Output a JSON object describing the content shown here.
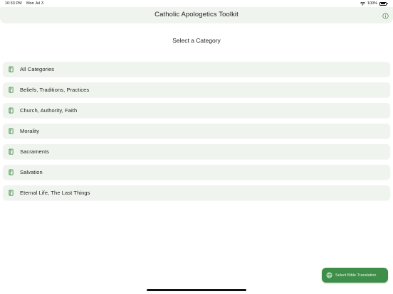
{
  "status_bar": {
    "time": "10:33 PM",
    "date": "Mon Jul 3",
    "battery": "100%"
  },
  "app_bar": {
    "title": "Catholic Apologetics Toolkit"
  },
  "main": {
    "section_title": "Select a Category",
    "categories": [
      {
        "label": "All Categories"
      },
      {
        "label": "Beliefs, Traditions, Practices"
      },
      {
        "label": "Church, Authority, Faith"
      },
      {
        "label": "Morality"
      },
      {
        "label": "Sacraments"
      },
      {
        "label": "Salvation"
      },
      {
        "label": "Eternal Life, The Last Things"
      }
    ]
  },
  "fab": {
    "label": "Select Bible Translation",
    "icon": "globe-icon"
  },
  "colors": {
    "accent": "#3e8e4a",
    "surface": "#f0f4ee",
    "icon": "#2e7d32"
  }
}
